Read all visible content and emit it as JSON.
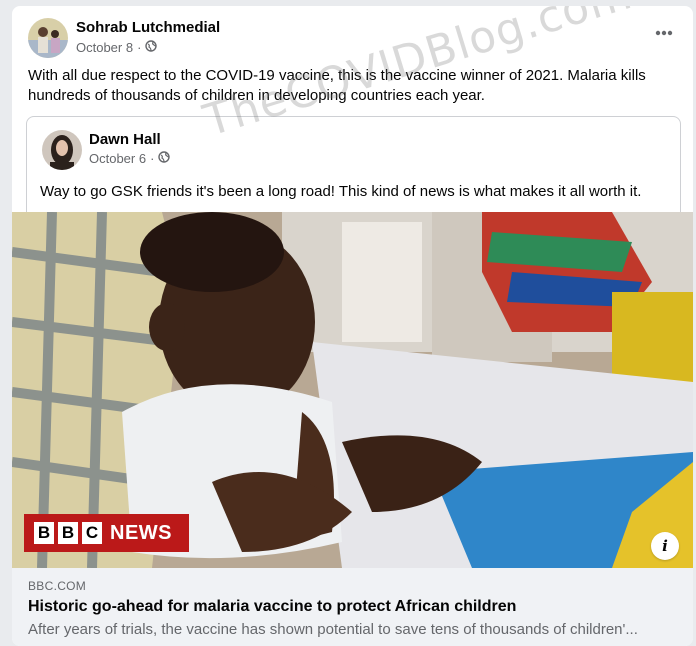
{
  "post": {
    "author": "Sohrab Lutchmedial",
    "date": "October 8",
    "separator": "·",
    "text": "With all due respect to the COVID-19 vaccine, this is the vaccine winner of 2021.  Malaria kills hundreds of thousands of children in developing countries each year."
  },
  "shared_post": {
    "author": "Dawn Hall",
    "date": "October 6",
    "separator": "·",
    "text": "Way to go GSK friends it's been a long road! This kind of news is what makes it all worth it."
  },
  "link": {
    "badge_letters": [
      "B",
      "B",
      "C"
    ],
    "badge_word": "NEWS",
    "domain": "BBC.COM",
    "headline": "Historic go-ahead for malaria vaccine to protect African children",
    "description": "After years of trials, the vaccine has shown potential to save tens of thousands of children'..."
  },
  "watermark": "TheCOVIDBlog.com",
  "icons": {
    "privacy": "globe-icon",
    "more": "more-options-icon",
    "info": "info-icon"
  },
  "colors": {
    "bbc_red": "#bb1919",
    "secondary_text": "#65676b",
    "footer_bg": "#f0f2f5"
  }
}
